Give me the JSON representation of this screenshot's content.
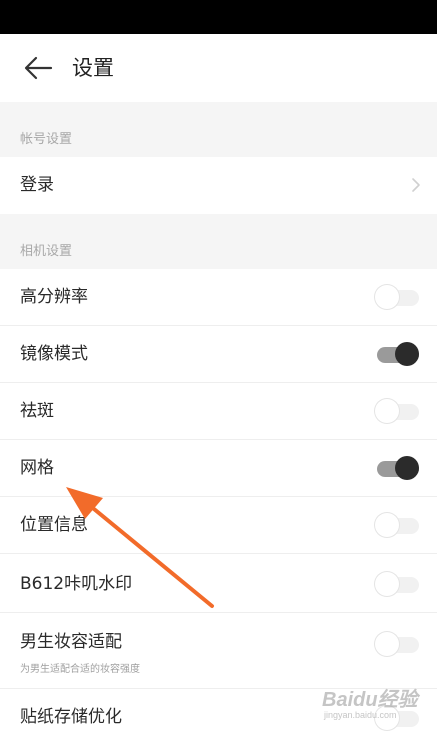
{
  "header": {
    "title": "设置",
    "back_icon": "arrow-left-icon"
  },
  "sections": [
    {
      "label": "帐号设置",
      "items": [
        {
          "label": "登录",
          "type": "link"
        }
      ]
    },
    {
      "label": "相机设置",
      "items": [
        {
          "label": "高分辨率",
          "type": "toggle",
          "on": false
        },
        {
          "label": "镜像模式",
          "type": "toggle",
          "on": true
        },
        {
          "label": "祛斑",
          "type": "toggle",
          "on": false
        },
        {
          "label": "网格",
          "type": "toggle",
          "on": true
        },
        {
          "label": "位置信息",
          "type": "toggle",
          "on": false
        },
        {
          "label": "B612咔叽水印",
          "type": "toggle",
          "on": false
        },
        {
          "label": "男生妆容适配",
          "sublabel": "为男生适配合适的妆容强度",
          "type": "toggle",
          "on": false
        },
        {
          "label": "贴纸存储优化",
          "type": "toggle",
          "on": false
        }
      ]
    }
  ],
  "annotation": {
    "color": "#f26b2a",
    "icon": "orange-arrow-annotation"
  },
  "watermark": {
    "logo": "Baidu经验",
    "url": "jingyan.baidu.com"
  },
  "colors": {
    "toggle_on_knob": "#2b2b2b",
    "toggle_on_track": "#9a9a9a",
    "toggle_off_track": "#f1f1f1",
    "section_bg": "#f5f5f5"
  }
}
